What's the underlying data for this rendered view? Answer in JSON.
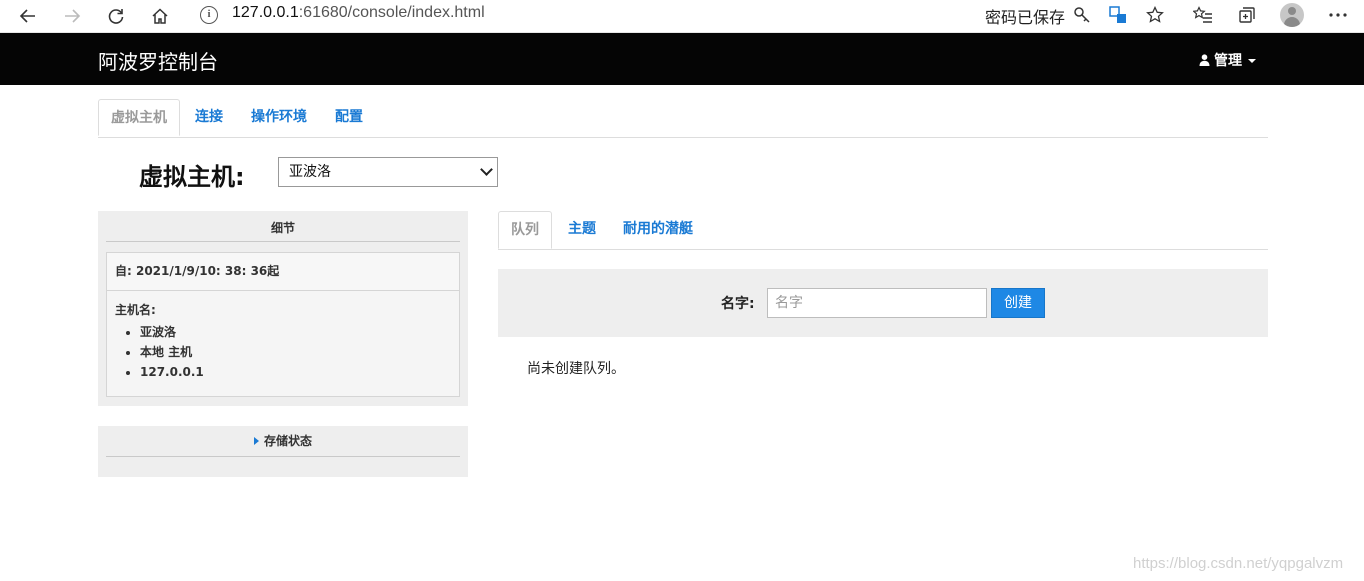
{
  "browser": {
    "url_prefix": "127.0.0.1",
    "url_rest": ":61680/console/index.html",
    "password_saved": "密码已保存"
  },
  "navbar": {
    "brand": "阿波罗控制台",
    "admin_label": "管理"
  },
  "main_tabs": [
    {
      "label": "虚拟主机",
      "active": true
    },
    {
      "label": "连接",
      "active": false
    },
    {
      "label": "操作环境",
      "active": false
    },
    {
      "label": "配置",
      "active": false
    }
  ],
  "vhost": {
    "label": "虚拟主机:",
    "selected": "亚波洛"
  },
  "details": {
    "title": "细节",
    "since": "自: 2021/1/9/10: 38: 36起",
    "hostname_label": "主机名:",
    "hostnames": [
      "亚波洛",
      "本地 主机",
      "127.0.0.1"
    ]
  },
  "storage": {
    "title": "存储状态"
  },
  "sub_tabs": [
    {
      "label": "队列",
      "active": true
    },
    {
      "label": "主题",
      "active": false
    },
    {
      "label": "耐用的潜艇",
      "active": false
    }
  ],
  "create_form": {
    "name_label": "名字:",
    "name_placeholder": "名字",
    "create_button": "创建"
  },
  "empty_message": "尚未创建队列。",
  "watermark": "https://blog.csdn.net/yqpgalvzm"
}
